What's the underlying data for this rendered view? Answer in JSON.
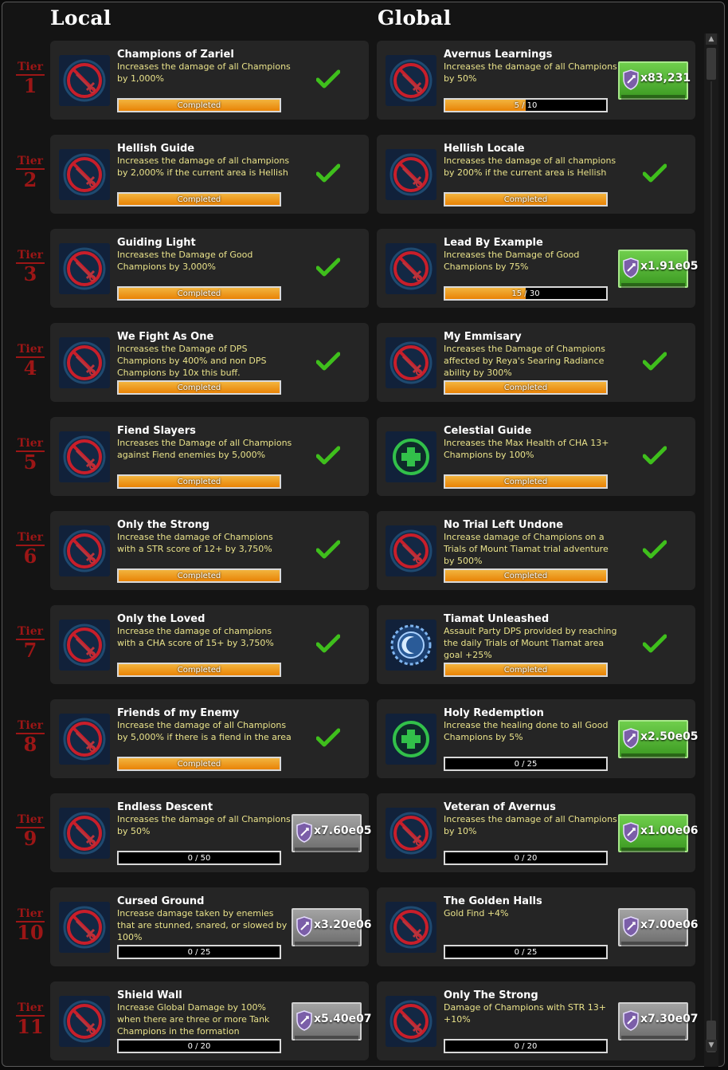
{
  "headers": {
    "local": "Local",
    "global": "Global"
  },
  "tier_word": "Tier",
  "rows": [
    {
      "tier": "1",
      "local": {
        "name": "Champions of Zariel",
        "desc": "Increases the damage of all Champions by 1,000%",
        "icon": "red-sword-icon",
        "status": "completed",
        "bar_text": "Completed",
        "progress": 1
      },
      "global": {
        "name": "Avernus Learnings",
        "desc": "Increases the damage of all Champions by 50%",
        "icon": "red-sword-icon",
        "status": "reward",
        "bar_text": "5 / 10",
        "progress": 0.5,
        "reward_color": "green",
        "reward_text": "x83,231"
      }
    },
    {
      "tier": "2",
      "local": {
        "name": "Hellish Guide",
        "desc": "Increases the damage of all champions by 2,000% if the current area is Hellish",
        "icon": "red-sword-icon",
        "status": "completed",
        "bar_text": "Completed",
        "progress": 1
      },
      "global": {
        "name": "Hellish Locale",
        "desc": "Increases the damage of all champions by 200% if the current area is Hellish",
        "icon": "red-sword-icon",
        "status": "completed",
        "bar_text": "Completed",
        "progress": 1
      }
    },
    {
      "tier": "3",
      "local": {
        "name": "Guiding Light",
        "desc": "Increases the Damage of Good Champions by 3,000%",
        "icon": "red-sword-icon",
        "status": "completed",
        "bar_text": "Completed",
        "progress": 1
      },
      "global": {
        "name": "Lead By Example",
        "desc": "Increases the Damage of Good Champions by 75%",
        "icon": "red-sword-icon",
        "status": "reward",
        "bar_text": "15 / 30",
        "progress": 0.5,
        "reward_color": "green",
        "reward_text": "x1.91e05"
      }
    },
    {
      "tier": "4",
      "local": {
        "name": "We Fight As One",
        "desc": "Increases the Damage of DPS Champions by 400% and non DPS Champions by 10x this buff.",
        "icon": "red-sword-icon",
        "status": "completed",
        "bar_text": "Completed",
        "progress": 1
      },
      "global": {
        "name": "My Emmisary",
        "desc": "Increases the Damage of Champions affected by Reya's Searing Radiance ability by 300%",
        "icon": "red-sword-icon",
        "status": "completed",
        "bar_text": "Completed",
        "progress": 1
      }
    },
    {
      "tier": "5",
      "local": {
        "name": "Fiend Slayers",
        "desc": "Increases the Damage of all Champions against Fiend enemies by 5,000%",
        "icon": "red-sword-icon",
        "status": "completed",
        "bar_text": "Completed",
        "progress": 1
      },
      "global": {
        "name": "Celestial Guide",
        "desc": "Increases the Max Health of CHA 13+ Champions by 100%",
        "icon": "green-cross-icon",
        "status": "completed",
        "bar_text": "Completed",
        "progress": 1
      }
    },
    {
      "tier": "6",
      "local": {
        "name": "Only the Strong",
        "desc": "Increase the damage of Champions with a STR score of 12+ by 3,750%",
        "icon": "red-sword-icon",
        "status": "completed",
        "bar_text": "Completed",
        "progress": 1
      },
      "global": {
        "name": "No Trial Left Undone",
        "desc": "Increase damage of Champions on a Trials of Mount Tiamat trial adventure by 500%",
        "icon": "red-sword-icon",
        "status": "completed",
        "bar_text": "Completed",
        "progress": 1
      }
    },
    {
      "tier": "7",
      "local": {
        "name": "Only the Loved",
        "desc": "Increase the damage of champions with a CHA score of 15+ by 3,750%",
        "icon": "red-sword-icon",
        "status": "completed",
        "bar_text": "Completed",
        "progress": 1
      },
      "global": {
        "name": "Tiamat Unleashed",
        "desc": "Assault Party DPS provided by reaching the daily Trials of Mount Tiamat area goal +25%",
        "icon": "blue-moon-icon",
        "status": "completed",
        "bar_text": "Completed",
        "progress": 1
      }
    },
    {
      "tier": "8",
      "local": {
        "name": "Friends of my Enemy",
        "desc": "Increase the damage of all Champions by 5,000% if there is a fiend in the area",
        "icon": "red-sword-icon",
        "status": "completed",
        "bar_text": "Completed",
        "progress": 1
      },
      "global": {
        "name": "Holy Redemption",
        "desc": "Increase the healing done to all Good Champions by 5%",
        "icon": "green-cross-icon",
        "status": "reward",
        "bar_text": "0 / 25",
        "progress": 0,
        "reward_color": "green",
        "reward_text": "x2.50e05"
      }
    },
    {
      "tier": "9",
      "local": {
        "name": "Endless Descent",
        "desc": "Increases the damage of all Champions by 50%",
        "icon": "red-sword-icon",
        "status": "reward",
        "bar_text": "0 / 50",
        "progress": 0,
        "reward_color": "grey",
        "reward_text": "x7.60e05"
      },
      "global": {
        "name": "Veteran of Avernus",
        "desc": "Increases the damage of all Champions by 10%",
        "icon": "red-sword-icon",
        "status": "reward",
        "bar_text": "0 / 20",
        "progress": 0,
        "reward_color": "green",
        "reward_text": "x1.00e06"
      }
    },
    {
      "tier": "10",
      "local": {
        "name": "Cursed Ground",
        "desc": "Increase damage taken by enemies that are stunned, snared, or slowed by 100%",
        "icon": "red-sword-icon",
        "status": "reward",
        "bar_text": "0 / 25",
        "progress": 0,
        "reward_color": "grey",
        "reward_text": "x3.20e06"
      },
      "global": {
        "name": "The Golden Halls",
        "desc": "Gold Find +4%",
        "icon": "red-sword-icon",
        "status": "reward",
        "bar_text": "0 / 25",
        "progress": 0,
        "reward_color": "grey",
        "reward_text": "x7.00e06"
      }
    },
    {
      "tier": "11",
      "local": {
        "name": "Shield Wall",
        "desc": "Increase Global Damage by 100% when there are three or more Tank Champions in the formation",
        "icon": "red-sword-icon",
        "status": "reward",
        "bar_text": "0 / 20",
        "progress": 0,
        "reward_color": "grey",
        "reward_text": "x5.40e07"
      },
      "global": {
        "name": "Only The Strong",
        "desc": "Damage of Champions with STR 13+ +10%",
        "icon": "red-sword-icon",
        "status": "reward",
        "bar_text": "0 / 20",
        "progress": 0,
        "reward_color": "grey",
        "reward_text": "x7.30e07"
      }
    }
  ],
  "colors": {
    "tier_red": "#9c1616",
    "desc_yellow": "#e9e28a",
    "progress_orange": "#e98306",
    "check_green": "#3fbf1c",
    "reward_green": "#4caf2c",
    "reward_grey": "#8a8a8a"
  }
}
